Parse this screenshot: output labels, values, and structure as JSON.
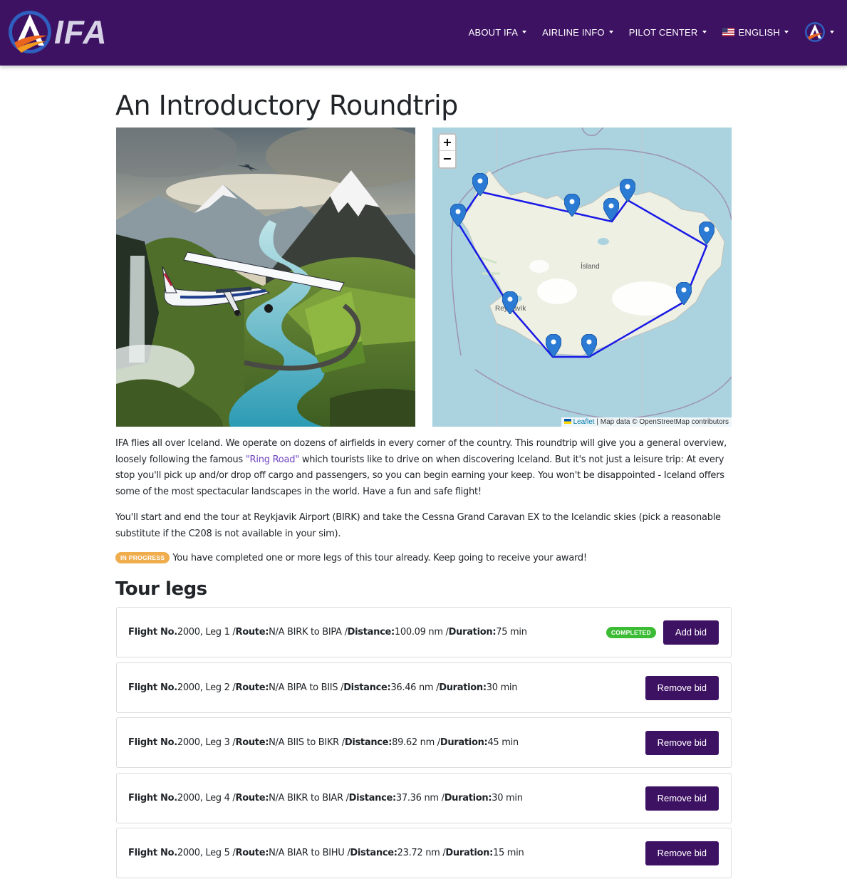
{
  "nav": {
    "brand": "IFA",
    "items": [
      {
        "label": "ABOUT IFA"
      },
      {
        "label": "AIRLINE INFO"
      },
      {
        "label": "PILOT CENTER"
      },
      {
        "label": "ENGLISH"
      }
    ]
  },
  "page": {
    "title": "An Introductory Roundtrip",
    "intro_before_link": "IFA flies all over Iceland. We operate on dozens of airfields in every corner of the country. This roundtrip will give you a general overview, loosely following the famous ",
    "intro_link": "\"Ring Road\"",
    "intro_after_link": " which tourists like to drive on when discovering Iceland. But it's not just a leisure trip: At every stop you'll pick up and/or drop off cargo and passengers, so you can begin earning your keep. You won't be disappointed - Iceland offers some of the most spectacular landscapes in the world. Have a fun and safe flight!",
    "start_text": "You'll start and end the tour at Reykjavik Airport (BIRK) and take the Cessna Grand Caravan EX to the Icelandic skies (pick a reasonable substitute if the C208 is not available in your sim).",
    "status_badge": "IN PROGRESS",
    "status_text": "You have completed one or more legs of this tour already. Keep going to receive your award!"
  },
  "map": {
    "zoom_in": "+",
    "zoom_out": "−",
    "attribution_link": "Leaflet",
    "attribution_text": " | Map data © OpenStreetMap contributors",
    "labels": {
      "country": "Ísland",
      "city": "Reykjavík"
    },
    "route_color": "#1a1ae6"
  },
  "legs": {
    "title": "Tour legs",
    "field_labels": {
      "flight": "Flight No.",
      "route": "Route:",
      "distance": "Distance:",
      "duration": "Duration:"
    },
    "items": [
      {
        "flight": " 2000, Leg 1 / ",
        "route": " N/A BIRK to BIPA / ",
        "distance": " 100.09 nm / ",
        "duration": " 75 min",
        "status": "COMPLETED",
        "button": "Add bid"
      },
      {
        "flight": " 2000, Leg 2 / ",
        "route": " N/A BIPA to BIIS / ",
        "distance": " 36.46 nm / ",
        "duration": " 30 min",
        "button": "Remove bid"
      },
      {
        "flight": " 2000, Leg 3 / ",
        "route": " N/A BIIS to BIKR / ",
        "distance": " 89.62 nm / ",
        "duration": " 45 min",
        "button": "Remove bid"
      },
      {
        "flight": " 2000, Leg 4 / ",
        "route": " N/A BIKR to BIAR / ",
        "distance": " 37.36 nm / ",
        "duration": " 30 min",
        "button": "Remove bid"
      },
      {
        "flight": " 2000, Leg 5 / ",
        "route": " N/A BIAR to BIHU / ",
        "distance": " 23.72 nm / ",
        "duration": " 15 min",
        "button": "Remove bid"
      }
    ]
  },
  "colors": {
    "brand": "#3d1263",
    "badge_progress": "#f0ad4e",
    "badge_completed": "#3cbc35",
    "link": "#6f42c1"
  }
}
